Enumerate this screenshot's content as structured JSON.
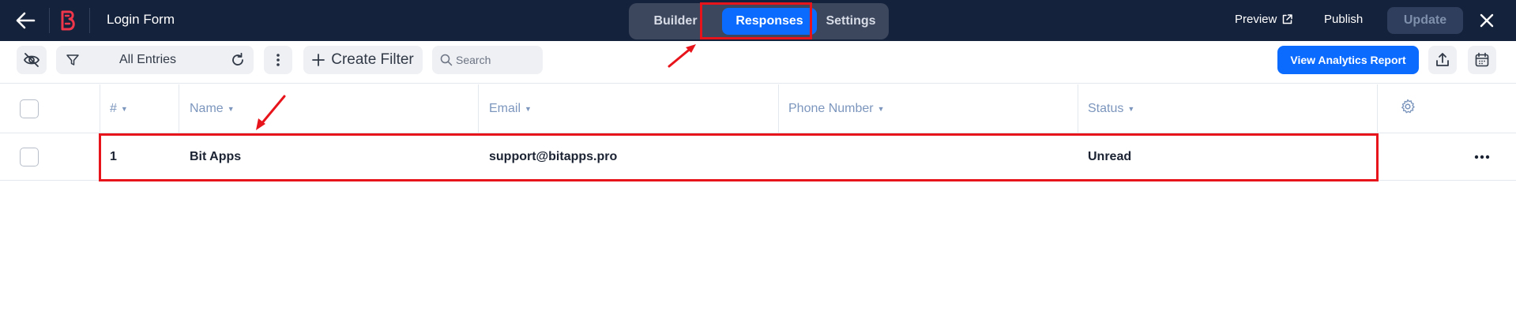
{
  "topbar": {
    "back_icon": "arrow-left-icon",
    "logo_icon": "bit-apps-logo-icon",
    "form_title": "Login Form",
    "tabs": [
      {
        "label": "Builder",
        "active": false
      },
      {
        "label": "Responses",
        "active": true
      },
      {
        "label": "Settings",
        "active": false
      }
    ],
    "preview_label": "Preview",
    "preview_icon": "external-link-icon",
    "publish_label": "Publish",
    "update_label": "Update",
    "close_icon": "close-icon"
  },
  "toolbar": {
    "hide_icon": "eye-off-icon",
    "filter_icon": "filter-icon",
    "entries_label": "All Entries",
    "refresh_icon": "refresh-icon",
    "more_icon": "vertical-dots-icon",
    "create_filter_label": "Create Filter",
    "search_placeholder": "Search",
    "search_value": "",
    "analytics_label": "View Analytics Report",
    "export_icon": "upload-icon",
    "calendar_icon": "calendar-icon"
  },
  "table": {
    "columns": [
      {
        "label": "#"
      },
      {
        "label": "Name"
      },
      {
        "label": "Email"
      },
      {
        "label": "Phone Number"
      },
      {
        "label": "Status"
      }
    ],
    "settings_icon": "gear-icon",
    "rows": [
      {
        "index": "1",
        "name": "Bit Apps",
        "email": "support@bitapps.pro",
        "phone": "",
        "status": "Unread"
      }
    ],
    "row_menu_icon": "horizontal-dots-icon"
  },
  "colors": {
    "topbar_bg": "#15223b",
    "accent": "#0b6bff",
    "annotation": "#e8141c",
    "header_text": "#7c96bd"
  }
}
